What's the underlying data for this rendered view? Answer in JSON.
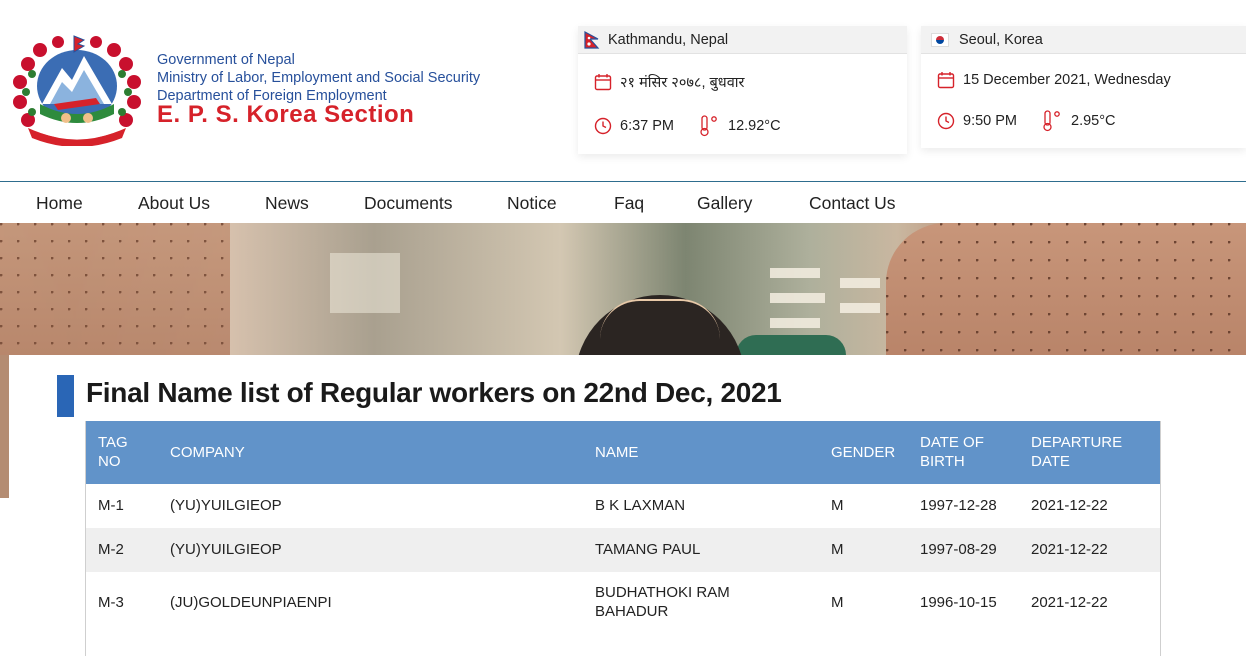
{
  "header": {
    "org_line1": "Government of Nepal",
    "org_line2": "Ministry of Labor, Employment and Social Security",
    "org_line3": "Department of Foreign Employment",
    "org_title": "E. P. S. Korea Section"
  },
  "clocks": {
    "nepal": {
      "city": "Kathmandu, Nepal",
      "date": "२१ मंसिर २०७८, बुधवार",
      "time": "6:37 PM",
      "temp": "12.92°C"
    },
    "korea": {
      "city": "Seoul, Korea",
      "date": "15 December 2021, Wednesday",
      "time": "9:50 PM",
      "temp": "2.95°C"
    }
  },
  "nav": {
    "items": [
      "Home",
      "About Us",
      "News",
      "Documents",
      "Notice",
      "Faq",
      "Gallery",
      "Contact Us"
    ]
  },
  "main": {
    "title": "Final Name list of Regular workers on 22nd Dec, 2021"
  },
  "table": {
    "headers": {
      "tag_no": "TAG NO",
      "company": "COMPANY",
      "name": "NAME",
      "gender": "GENDER",
      "dob": "DATE OF BIRTH",
      "departure": "DEPARTURE DATE"
    },
    "rows": [
      {
        "tag": "M-1",
        "company": "(YU)YUILGIEOP",
        "name": "B K LAXMAN",
        "gender": "M",
        "dob": "1997-12-28",
        "departure": "2021-12-22"
      },
      {
        "tag": "M-2",
        "company": "(YU)YUILGIEOP",
        "name": "TAMANG PAUL",
        "gender": "M",
        "dob": "1997-08-29",
        "departure": "2021-12-22"
      },
      {
        "tag": "M-3",
        "company": "(JU)GOLDEUNPIAENPI",
        "name": "BUDHATHOKI RAM BAHADUR",
        "gender": "M",
        "dob": "1996-10-15",
        "departure": "2021-12-22"
      }
    ]
  },
  "colors": {
    "brand_red": "#d6222a",
    "brand_blue": "#27509b",
    "table_header": "#6193c9",
    "title_accent": "#2a66b6"
  }
}
